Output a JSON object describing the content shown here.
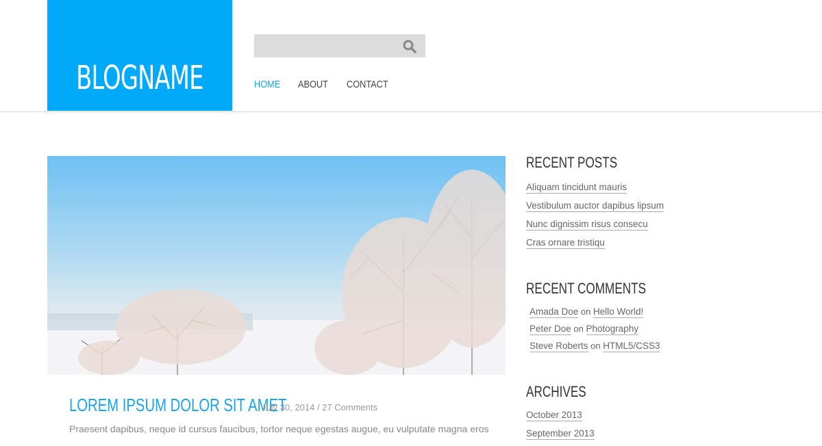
{
  "header": {
    "logo": "BLOGNAME",
    "search": {
      "placeholder": "",
      "value": ""
    },
    "nav": [
      {
        "label": "HOME",
        "active": true
      },
      {
        "label": "ABOUT"
      },
      {
        "label": "CONTACT"
      }
    ]
  },
  "post": {
    "title": "LOREM IPSUM DOLOR SIT AMET",
    "meta": "July 30, 2014 / 27 Comments",
    "excerpt": "Praesent dapibus, neque id cursus faucibus, tortor neque egestas augue, eu vulputate magna eros"
  },
  "sidebar": {
    "recent_posts": {
      "title": "RECENT POSTS",
      "items": [
        "Aliquam tincidunt mauris",
        "Vestibulum auctor dapibus lipsum",
        "Nunc dignissim risus consecu",
        "Cras ornare tristiqu"
      ]
    },
    "recent_comments": {
      "title": "RECENT COMMENTS",
      "on": "on",
      "items": [
        {
          "author": "Amada Doe",
          "post": "Hello World!"
        },
        {
          "author": "Peter Doe",
          "post": "Photography"
        },
        {
          "author": "Steve Roberts",
          "post": "HTML5/CSS3"
        }
      ]
    },
    "archives": {
      "title": "ARCHIVES",
      "items": [
        "October 2013",
        "September 2013"
      ]
    }
  },
  "colors": {
    "accent": "#00a9f9"
  }
}
